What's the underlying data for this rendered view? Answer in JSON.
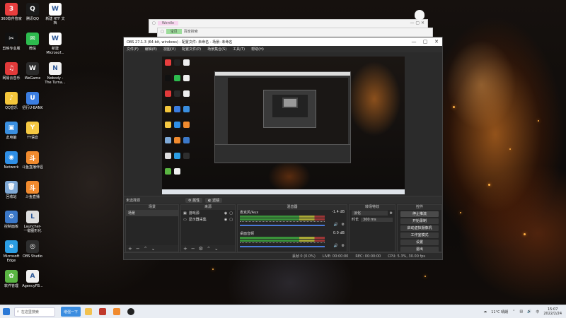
{
  "desktop": {
    "icons": [
      {
        "label": "360软件管家",
        "color": "#e83e3e",
        "glyph": "3"
      },
      {
        "label": "腾讯QQ",
        "color": "#1a1a1a",
        "glyph": "Q"
      },
      {
        "label": "新建 RTF 文\n档",
        "color": "#ffffff",
        "glyph": "W"
      },
      {
        "label": "剪映专业版",
        "color": "#111111",
        "glyph": "✂"
      },
      {
        "label": "微信",
        "color": "#2dbb4e",
        "glyph": "✉"
      },
      {
        "label": "新建\nMicrosof...",
        "color": "#ffffff",
        "glyph": "W"
      },
      {
        "label": "网易云音乐",
        "color": "#e23a3a",
        "glyph": "♫"
      },
      {
        "label": "WeGame",
        "color": "#2a2a2a",
        "glyph": "W"
      },
      {
        "label": "Nobody -\nThe Turna...",
        "color": "#f2f2f2",
        "glyph": "N"
      },
      {
        "label": "QQ音乐",
        "color": "#f4c63b",
        "glyph": "♪"
      },
      {
        "label": "招行U-BANK",
        "color": "#3b7de0",
        "glyph": "U"
      },
      {
        "label": "此电脑",
        "color": "#3a8fe0",
        "glyph": "▣"
      },
      {
        "label": "YY语音",
        "color": "#f5c842",
        "glyph": "Y"
      },
      {
        "label": "Network",
        "color": "#2f8fe6",
        "glyph": "◉"
      },
      {
        "label": "斗鱼直播伴侣",
        "color": "#f08a2e",
        "glyph": "斗"
      },
      {
        "label": "回收站",
        "color": "#7fa9d6",
        "glyph": "🗑"
      },
      {
        "label": "斗鱼直播",
        "color": "#f08a2e",
        "glyph": "斗"
      },
      {
        "label": "控制面板",
        "color": "#3b78c8",
        "glyph": "⚙"
      },
      {
        "label": "Launcher-\n一键图形化",
        "color": "#dedede",
        "glyph": "L"
      },
      {
        "label": "Microsoft\nEdge",
        "color": "#2b9de3",
        "glyph": "e"
      },
      {
        "label": "OBS Studio",
        "color": "#2e2e2e",
        "glyph": "◎"
      },
      {
        "label": "软件管理",
        "color": "#5ab542",
        "glyph": "✿"
      },
      {
        "label": "AgencyFB...",
        "color": "#f0f0f0",
        "glyph": "A"
      }
    ]
  },
  "bg_windows": {
    "win1_tab": "Wordle",
    "win2_tab": "宝贝",
    "win2_tab2": "百度搜索"
  },
  "obs": {
    "title": "OBS 27.1.3 (64-bit, windows) - 配置文件: 未命名 - 场景: 未命名",
    "menu": [
      "文件(F)",
      "编辑(E)",
      "视图(V)",
      "配置文件(P)",
      "场景集合(S)",
      "工具(T)",
      "帮助(H)"
    ],
    "no_source": "未选择源",
    "props_btn": "属性",
    "filters_btn": "滤镜",
    "docks": {
      "scenes": {
        "title": "场景",
        "items": [
          "场景"
        ]
      },
      "sources": {
        "title": "来源",
        "items": [
          "游戏源",
          "显示器采集"
        ]
      },
      "mixer": {
        "title": "混音器",
        "channels": [
          {
            "name": "麦克风/Aux",
            "db": "-1.4 dB"
          },
          {
            "name": "桌面音频",
            "db": "0.0 dB"
          }
        ]
      },
      "transitions": {
        "title": "转场特效",
        "type": "淡化",
        "duration_label": "时长",
        "duration": "300 ms"
      },
      "controls": {
        "title": "控件",
        "buttons": [
          "停止推流",
          "开始录制",
          "启动虚拟摄像机",
          "工作室模式",
          "设置",
          "退出"
        ]
      }
    },
    "status": {
      "drop": "丢帧 0 (0.0%)",
      "live": "LIVE: 00:00:00",
      "rec": "REC: 00:00:00",
      "cpu": "CPU: 5.3%, 30.00 fps"
    }
  },
  "taskbar": {
    "search_placeholder": "在这里搜索",
    "active_app": "增强一下",
    "weather": "11°C  晴朗",
    "time": "15:07",
    "date": "2022/2/24"
  }
}
